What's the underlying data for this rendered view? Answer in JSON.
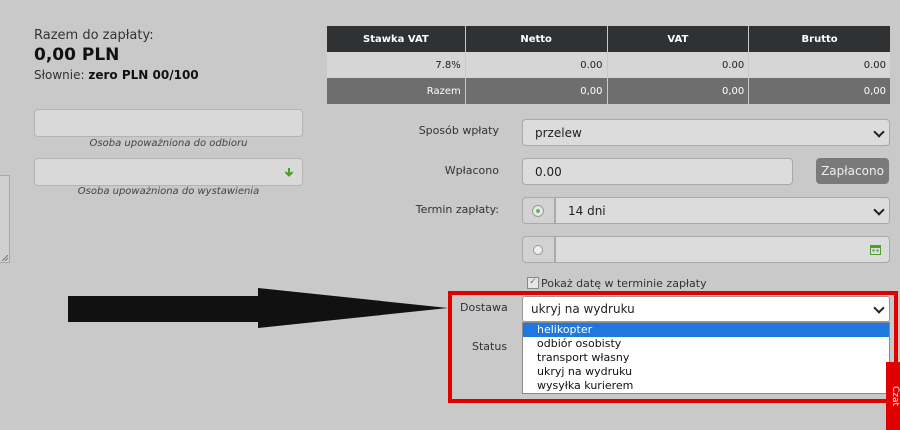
{
  "summary": {
    "total_label": "Razem do zapłaty:",
    "total_amount": "0,00 PLN",
    "words_label": "Słownie:",
    "words_value": "zero PLN 00/100"
  },
  "left_fields": {
    "receiver_caption": "Osoba upoważniona do odbioru",
    "issuer_caption": "Osoba upoważniona do wystawienia"
  },
  "vat_table": {
    "headers": [
      "Stawka VAT",
      "Netto",
      "VAT",
      "Brutto"
    ],
    "row": [
      "7.8%",
      "0.00",
      "0.00",
      "0.00"
    ],
    "sum_row": [
      "Razem",
      "0,00",
      "0,00",
      "0,00"
    ]
  },
  "form": {
    "payment_method_label": "Sposób wpłaty",
    "payment_method_value": "przelew",
    "paid_label": "Wpłacono",
    "paid_value": "0.00",
    "paid_button": "Zapłacono",
    "due_label": "Termin zapłaty:",
    "due_value": "14 dni",
    "show_date_label": "Pokaż datę w terminie zapłaty",
    "delivery_label": "Dostawa",
    "delivery_value": "ukryj na wydruku",
    "status_label": "Status"
  },
  "delivery_options": [
    "helikopter",
    "odbiór osobisty",
    "transport własny",
    "ukryj na wydruku",
    "wysyłka kurierem"
  ],
  "side_tab": "Czat",
  "colors": {
    "highlight": "#e00000",
    "selected_option": "#1f78e0"
  }
}
